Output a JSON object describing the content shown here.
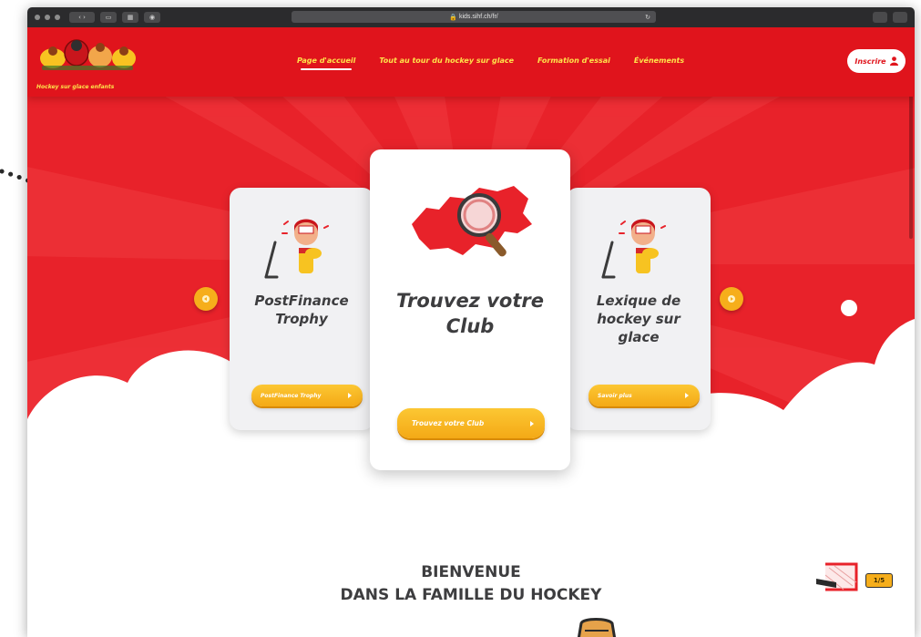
{
  "browser": {
    "address": "kids.sihf.ch/fr/"
  },
  "header": {
    "logo_text": "Hockey sur glace enfants",
    "nav": [
      {
        "label": "Page d'accueil",
        "active": true
      },
      {
        "label": "Tout au tour du hockey sur glace",
        "active": false
      },
      {
        "label": "Formation d'essai",
        "active": false
      },
      {
        "label": "Événements",
        "active": false
      }
    ],
    "signup_label": "Inscrire"
  },
  "carousel": {
    "cards": [
      {
        "title": "PostFinance Trophy",
        "button": "PostFinance Trophy",
        "icon": "hockey-player-icon"
      },
      {
        "title": "Trouvez votre Club",
        "button": "Trouvez votre Club",
        "icon": "switzerland-map-magnifier-icon"
      },
      {
        "title": "Lexique de hockey sur glace",
        "button": "Savoir plus",
        "icon": "hockey-player-icon"
      }
    ]
  },
  "welcome": {
    "line1": "BIENVENUE",
    "line2": "DANS LA FAMILLE DU HOCKEY"
  },
  "progress": {
    "counter": "1/5",
    "current": 1,
    "total": 5
  },
  "colors": {
    "primary_red": "#e8222a",
    "header_red": "#e0141c",
    "accent_yellow": "#f6ae1b",
    "nav_text": "#ffe34a",
    "card_text": "#3d3d3f"
  }
}
